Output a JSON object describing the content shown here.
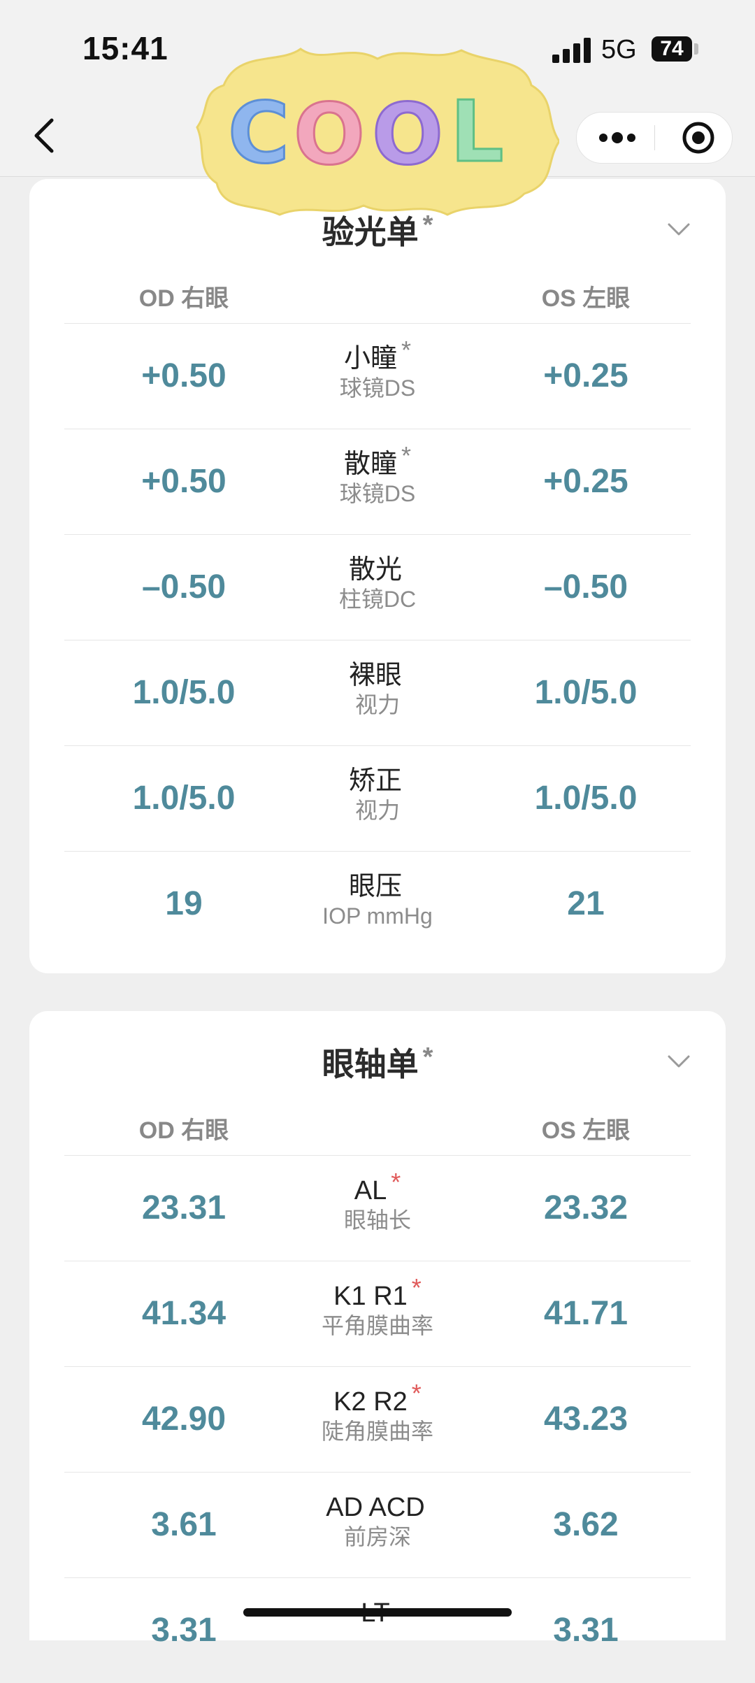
{
  "status": {
    "time": "15:41",
    "network": "5G",
    "battery": "74"
  },
  "nav": {
    "sticker_text": "COOL"
  },
  "refraction": {
    "title": "验光单",
    "title_mark": "*",
    "od_header": "OD 右眼",
    "os_header": "OS 左眼",
    "rows": [
      {
        "name": "小瞳",
        "mark": "*",
        "sub": "球镜DS",
        "od": "+0.50",
        "os": "+0.25"
      },
      {
        "name": "散瞳",
        "mark": "*",
        "sub": "球镜DS",
        "od": "+0.50",
        "os": "+0.25"
      },
      {
        "name": "散光",
        "mark": "",
        "sub": "柱镜DC",
        "od": "–0.50",
        "os": "–0.50"
      },
      {
        "name": "裸眼",
        "mark": "",
        "sub": "视力",
        "od": "1.0/5.0",
        "os": "1.0/5.0"
      },
      {
        "name": "矫正",
        "mark": "",
        "sub": "视力",
        "od": "1.0/5.0",
        "os": "1.0/5.0"
      },
      {
        "name": "眼压",
        "mark": "",
        "sub": "IOP mmHg",
        "od": "19",
        "os": "21"
      }
    ]
  },
  "axial": {
    "title": "眼轴单",
    "title_mark": "*",
    "od_header": "OD 右眼",
    "os_header": "OS 左眼",
    "rows": [
      {
        "name": "AL",
        "mark": "*",
        "sub": "眼轴长",
        "od": "23.31",
        "os": "23.32"
      },
      {
        "name": "K1 R1",
        "mark": "*",
        "sub": "平角膜曲率",
        "od": "41.34",
        "os": "41.71"
      },
      {
        "name": "K2 R2",
        "mark": "*",
        "sub": "陡角膜曲率",
        "od": "42.90",
        "os": "43.23"
      },
      {
        "name": "AD ACD",
        "mark": "",
        "sub": "前房深",
        "od": "3.61",
        "os": "3.62"
      },
      {
        "name": "LT",
        "mark": "",
        "sub": "",
        "od": "3.31",
        "os": "3.31"
      }
    ]
  },
  "colors": {
    "value": "#4f8a9b",
    "required_mark": "#e05a5a",
    "optional_mark": "#888888"
  }
}
